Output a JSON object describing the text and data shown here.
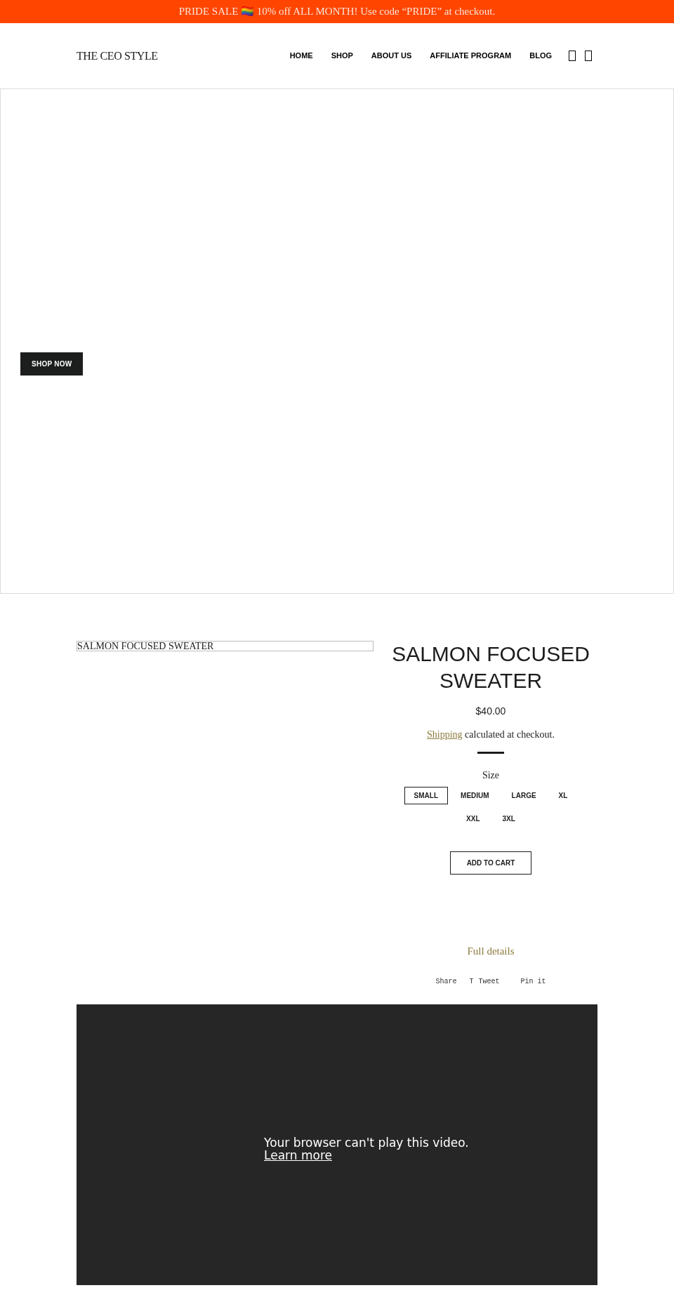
{
  "announcement": "PRIDE SALE 🏳️‍🌈 10% off ALL MONTH! Use code “PRIDE” at checkout.",
  "header": {
    "logo": "THE CEO STYLE",
    "nav": [
      {
        "label": "HOME"
      },
      {
        "label": "SHOP"
      },
      {
        "label": "ABOUT US"
      },
      {
        "label": "AFFILIATE PROGRAM"
      },
      {
        "label": "BLOG"
      }
    ]
  },
  "hero": {
    "button": "SHOP NOW"
  },
  "product": {
    "image_alt": "SALMON FOCUSED SWEATER",
    "title": "SALMON FOCUSED SWEATER",
    "price": "$40.00",
    "shipping_link": "Shipping",
    "shipping_text": " calculated at checkout.",
    "size_label": "Size",
    "sizes": [
      {
        "label": "SMALL",
        "selected": true
      },
      {
        "label": "MEDIUM",
        "selected": false
      },
      {
        "label": "LARGE",
        "selected": false
      },
      {
        "label": "XL",
        "selected": false
      },
      {
        "label": "XXL",
        "selected": false
      },
      {
        "label": "3XL",
        "selected": false
      }
    ],
    "add_to_cart": "ADD TO CART",
    "full_details": "Full details",
    "social": [
      {
        "kind": "plain",
        "label": "Share"
      },
      {
        "kind": "icon",
        "icon": "T",
        "label": "Tweet"
      },
      {
        "kind": "plain",
        "label": "Pin it"
      }
    ]
  },
  "video": {
    "message": "Your browser can't play this video.",
    "link": "Learn more"
  }
}
